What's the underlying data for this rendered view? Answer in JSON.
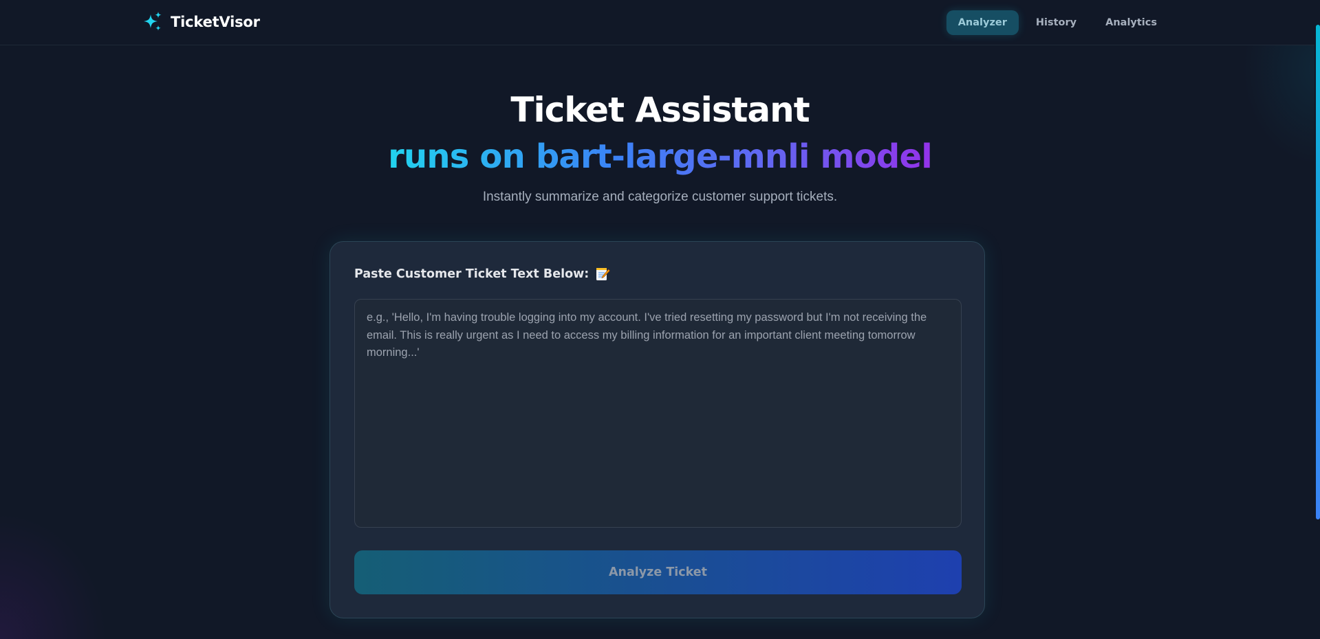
{
  "app": {
    "name": "TicketVisor",
    "logo_icon": "sparkles-icon",
    "accent": "#22d3ee"
  },
  "nav": {
    "items": [
      {
        "label": "Analyzer",
        "active": true
      },
      {
        "label": "History",
        "active": false
      },
      {
        "label": "Analytics",
        "active": false
      }
    ]
  },
  "hero": {
    "title": "Ticket Assistant",
    "subtitle": "runs on bart-large-mnli model",
    "tagline": "Instantly summarize and categorize customer support tickets.",
    "subtitle_gradient": [
      "#22d3ee",
      "#3b82f6",
      "#6366f1",
      "#9333ea"
    ]
  },
  "form": {
    "label": "Paste Customer Ticket Text Below:",
    "label_icon": "memo-icon",
    "value": "",
    "placeholder": "e.g., 'Hello, I'm having trouble logging into my account. I've tried resetting my password but I'm not receiving the email. This is really urgent as I need to access my billing information for an important client meeting tomorrow morning...'",
    "submit_label": "Analyze Ticket"
  }
}
